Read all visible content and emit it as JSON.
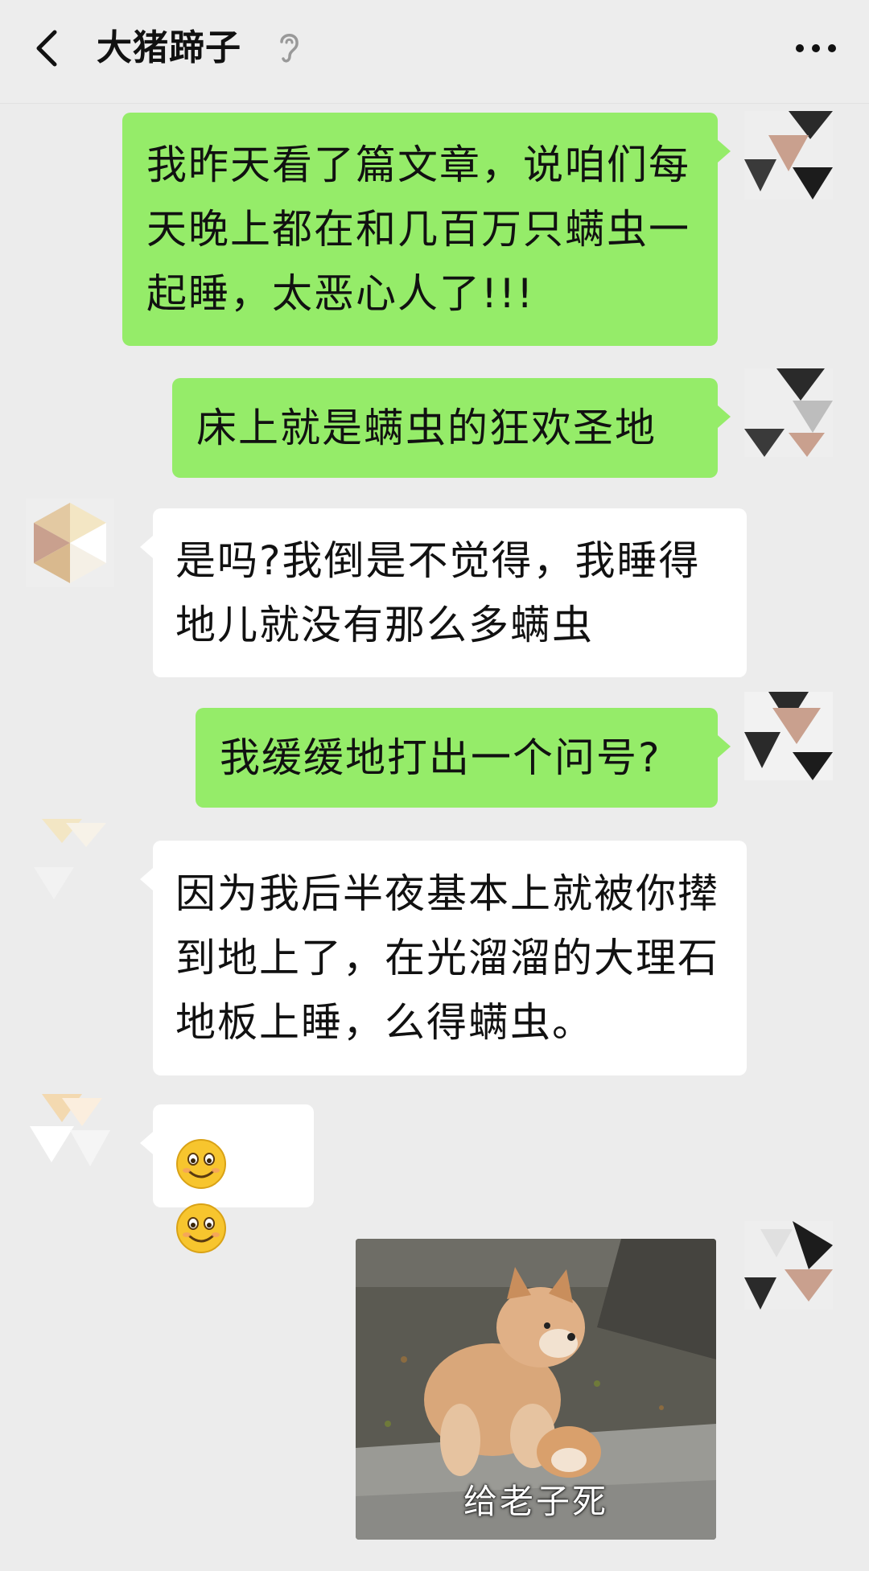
{
  "header": {
    "title": "大猪蹄子"
  },
  "messages": [
    {
      "side": "right",
      "text": "我昨天看了篇文章，说咱们每天晚上都在和几百万只螨虫一起睡，太恶心人了!!!"
    },
    {
      "side": "right",
      "text": "床上就是螨虫的狂欢圣地"
    },
    {
      "side": "left",
      "text": "是吗?我倒是不觉得，我睡得地儿就没有那么多螨虫"
    },
    {
      "side": "right",
      "text": "我缓缓地打出一个问号?"
    },
    {
      "side": "left",
      "text": "因为我后半夜基本上就被你撵到地上了，在光溜溜的大理石地板上睡，么得螨虫。"
    },
    {
      "side": "left",
      "emoji": [
        "smile-emoji",
        "smile-emoji"
      ]
    },
    {
      "side": "right",
      "image": {
        "subject": "shiba-puppy-photo",
        "caption": "给老子死"
      }
    }
  ],
  "colors": {
    "background": "#ececec",
    "header": "#ededed",
    "sent_bubble": "#95ec69",
    "received_bubble": "#ffffff",
    "emoji_yellow": "#f7c52e"
  },
  "icons": [
    "back-chevron-icon",
    "mute-ear-icon",
    "more-dots-icon"
  ]
}
